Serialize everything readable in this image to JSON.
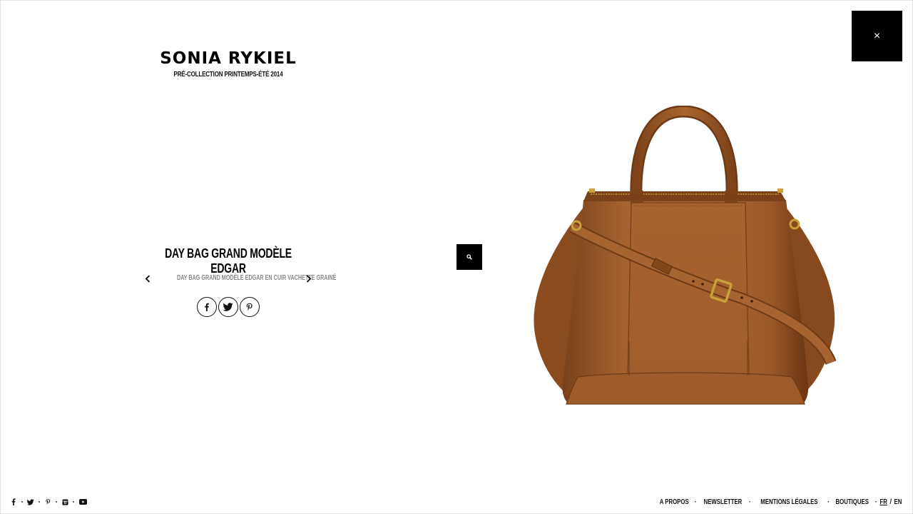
{
  "brand": {
    "name": "SONIA RYKIEL",
    "collection": "PRÉ-COLLECTION PRINTEMPS-ÉTÉ 2014"
  },
  "product": {
    "title": "DAY BAG GRAND MODÈLE EDGAR",
    "description": "DAY BAG GRAND MODÈLE EDGAR EN CUIR VACHETTE GRAINÉ"
  },
  "close": {
    "icon": "close-icon",
    "label": "×"
  },
  "share": [
    {
      "name": "facebook-icon"
    },
    {
      "name": "twitter-icon"
    },
    {
      "name": "pinterest-icon"
    }
  ],
  "footer": {
    "social": [
      "facebook-icon",
      "twitter-icon",
      "pinterest-icon",
      "instagram-icon",
      "youtube-icon"
    ],
    "links": {
      "about": "A PROPOS",
      "newsletter": "NEWSLETTER",
      "legal": "MENTIONS LÉGALES",
      "stores": "BOUTIQUES"
    },
    "lang": {
      "fr": "FR",
      "sep": "/",
      "en": "EN"
    },
    "separator": "·"
  },
  "colors": {
    "black": "#000000",
    "leather": "#9a5a2c",
    "leather_dark": "#6e3b17",
    "gold": "#c9a13b"
  }
}
